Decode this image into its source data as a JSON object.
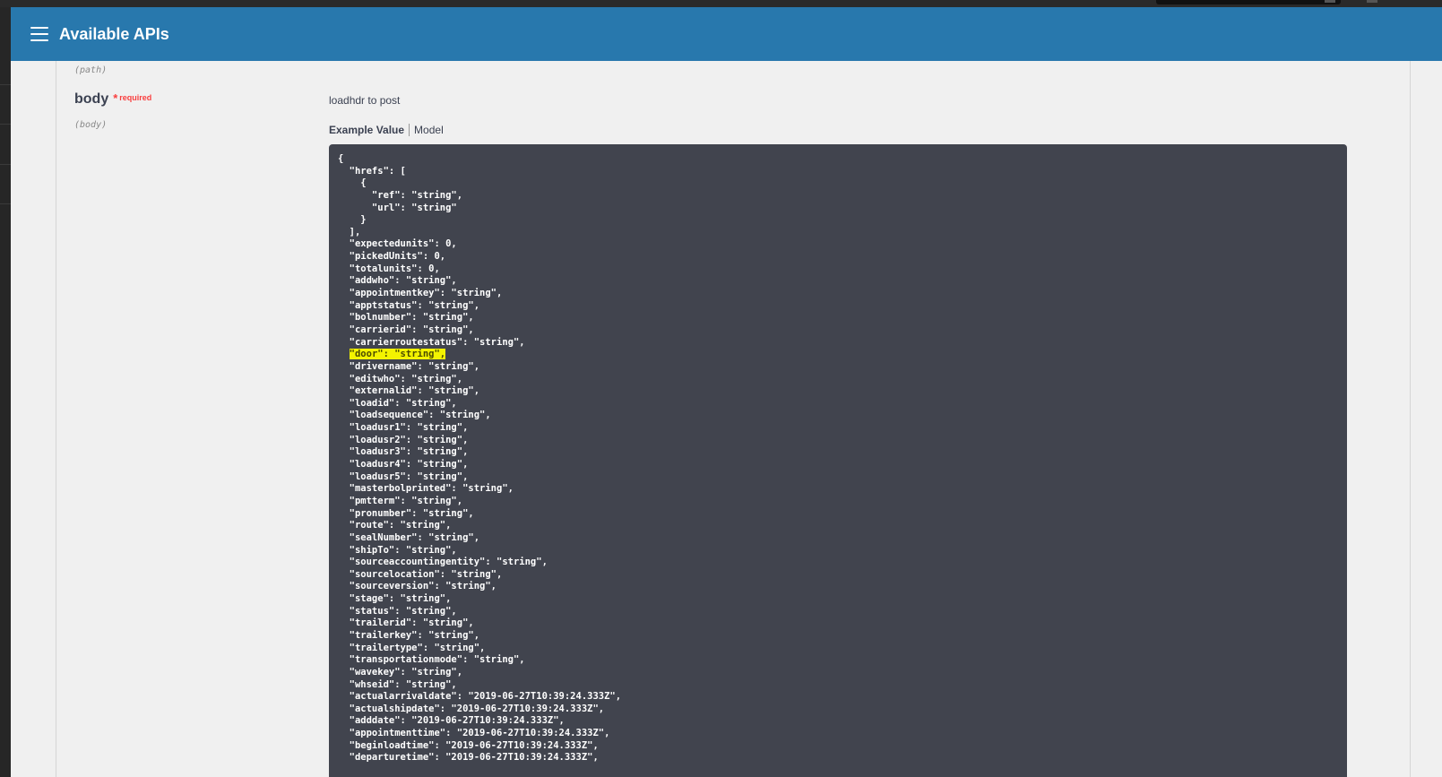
{
  "header": {
    "title": "Available APIs",
    "menu_icon": "hamburger-menu-icon"
  },
  "params": {
    "prev_in": "(path)",
    "body": {
      "name": "body",
      "required_star": "*",
      "required_text": "required",
      "in": "(body)",
      "description": "loadhdr to post"
    }
  },
  "example_tabs": {
    "example_value": "Example Value",
    "model": "Model"
  },
  "code": {
    "lines": [
      "{",
      "  \"hrefs\": [",
      "    {",
      "      \"ref\": \"string\",",
      "      \"url\": \"string\"",
      "    }",
      "  ],",
      "  \"expectedunits\": 0,",
      "  \"pickedUnits\": 0,",
      "  \"totalunits\": 0,",
      "  \"addwho\": \"string\",",
      "  \"appointmentkey\": \"string\",",
      "  \"apptstatus\": \"string\",",
      "  \"bolnumber\": \"string\",",
      "  \"carrierid\": \"string\",",
      "  \"carrierroutestatus\": \"string\",",
      "  \"door\": \"string\",",
      "  \"drivername\": \"string\",",
      "  \"editwho\": \"string\",",
      "  \"externalid\": \"string\",",
      "  \"loadid\": \"string\",",
      "  \"loadsequence\": \"string\",",
      "  \"loadusr1\": \"string\",",
      "  \"loadusr2\": \"string\",",
      "  \"loadusr3\": \"string\",",
      "  \"loadusr4\": \"string\",",
      "  \"loadusr5\": \"string\",",
      "  \"masterbolprinted\": \"string\",",
      "  \"pmtterm\": \"string\",",
      "  \"pronumber\": \"string\",",
      "  \"route\": \"string\",",
      "  \"sealNumber\": \"string\",",
      "  \"shipTo\": \"string\",",
      "  \"sourceaccountingentity\": \"string\",",
      "  \"sourcelocation\": \"string\",",
      "  \"sourceversion\": \"string\",",
      "  \"stage\": \"string\",",
      "  \"status\": \"string\",",
      "  \"trailerid\": \"string\",",
      "  \"trailerkey\": \"string\",",
      "  \"trailertype\": \"string\",",
      "  \"transportationmode\": \"string\",",
      "  \"wavekey\": \"string\",",
      "  \"whseid\": \"string\",",
      "  \"actualarrivaldate\": \"2019-06-27T10:39:24.333Z\",",
      "  \"actualshipdate\": \"2019-06-27T10:39:24.333Z\",",
      "  \"adddate\": \"2019-06-27T10:39:24.333Z\",",
      "  \"appointmenttime\": \"2019-06-27T10:39:24.333Z\",",
      "  \"beginloadtime\": \"2019-06-27T10:39:24.333Z\",",
      "  \"departuretime\": \"2019-06-27T10:39:24.333Z\","
    ],
    "highlight_index": 16,
    "highlight_color": "#f3f300",
    "background_color": "#41444e"
  },
  "colors": {
    "header_bg": "#2878ad",
    "page_bg": "#f0f0f0",
    "required": "#f93e3e"
  }
}
